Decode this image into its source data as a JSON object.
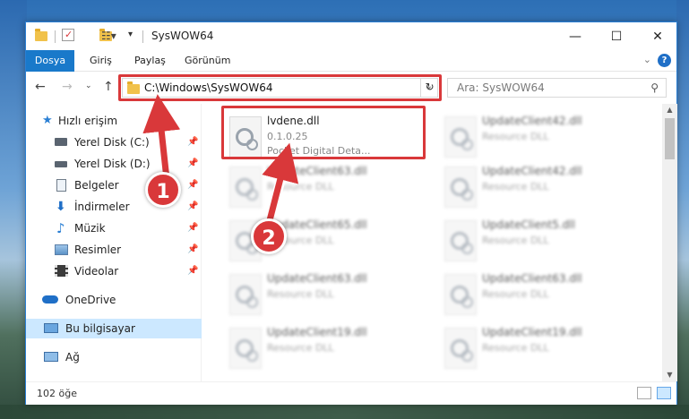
{
  "window": {
    "title": "SysWOW64",
    "controls": {
      "minimize": "—",
      "maximize": "☐",
      "close": "✕"
    }
  },
  "ribbon": {
    "tabs": [
      "Dosya",
      "Giriş",
      "Paylaş",
      "Görünüm"
    ],
    "help": "?"
  },
  "navigation": {
    "address": "C:\\Windows\\SysWOW64",
    "search_placeholder": "Ara: SysWOW64"
  },
  "sidebar": {
    "quick_access": "Hızlı erişim",
    "items": [
      {
        "label": "Yerel Disk (C:)",
        "icon": "drive-icon",
        "pinned": true
      },
      {
        "label": "Yerel Disk (D:)",
        "icon": "drive-icon",
        "pinned": true
      },
      {
        "label": "Belgeler",
        "icon": "documents-icon",
        "pinned": true
      },
      {
        "label": "İndirmeler",
        "icon": "download-icon",
        "pinned": true
      },
      {
        "label": "Müzik",
        "icon": "music-icon",
        "pinned": true
      },
      {
        "label": "Resimler",
        "icon": "pictures-icon",
        "pinned": true
      },
      {
        "label": "Videolar",
        "icon": "video-icon",
        "pinned": true
      }
    ],
    "onedrive": "OneDrive",
    "this_pc": "Bu bilgisayar",
    "network": "Ağ"
  },
  "files": {
    "highlighted": {
      "name": "lvdene.dll",
      "version": "0.1.0.25",
      "description": "Pocket Digital Deta..."
    },
    "left_column": [
      {
        "name": "UpdateClient63.dll",
        "type": "Resource DLL"
      },
      {
        "name": "UpdateClient65.dll",
        "type": "Resource DLL"
      },
      {
        "name": "UpdateClient63.dll",
        "type": "Resource DLL"
      },
      {
        "name": "UpdateClient19.dll",
        "type": "Resource DLL"
      }
    ],
    "right_column": [
      {
        "name": "UpdateClient42.dll",
        "type": "Resource DLL"
      },
      {
        "name": "UpdateClient42.dll",
        "type": "Resource DLL"
      },
      {
        "name": "UpdateClient5.dll",
        "type": "Resource DLL"
      },
      {
        "name": "UpdateClient63.dll",
        "type": "Resource DLL"
      },
      {
        "name": "UpdateClient19.dll",
        "type": "Resource DLL"
      }
    ]
  },
  "status": {
    "item_count": "102 öğe"
  },
  "annotations": {
    "step1": "1",
    "step2": "2"
  },
  "colors": {
    "accent": "#1979ca",
    "annotation": "#d9383a",
    "selection": "#cce8ff"
  }
}
